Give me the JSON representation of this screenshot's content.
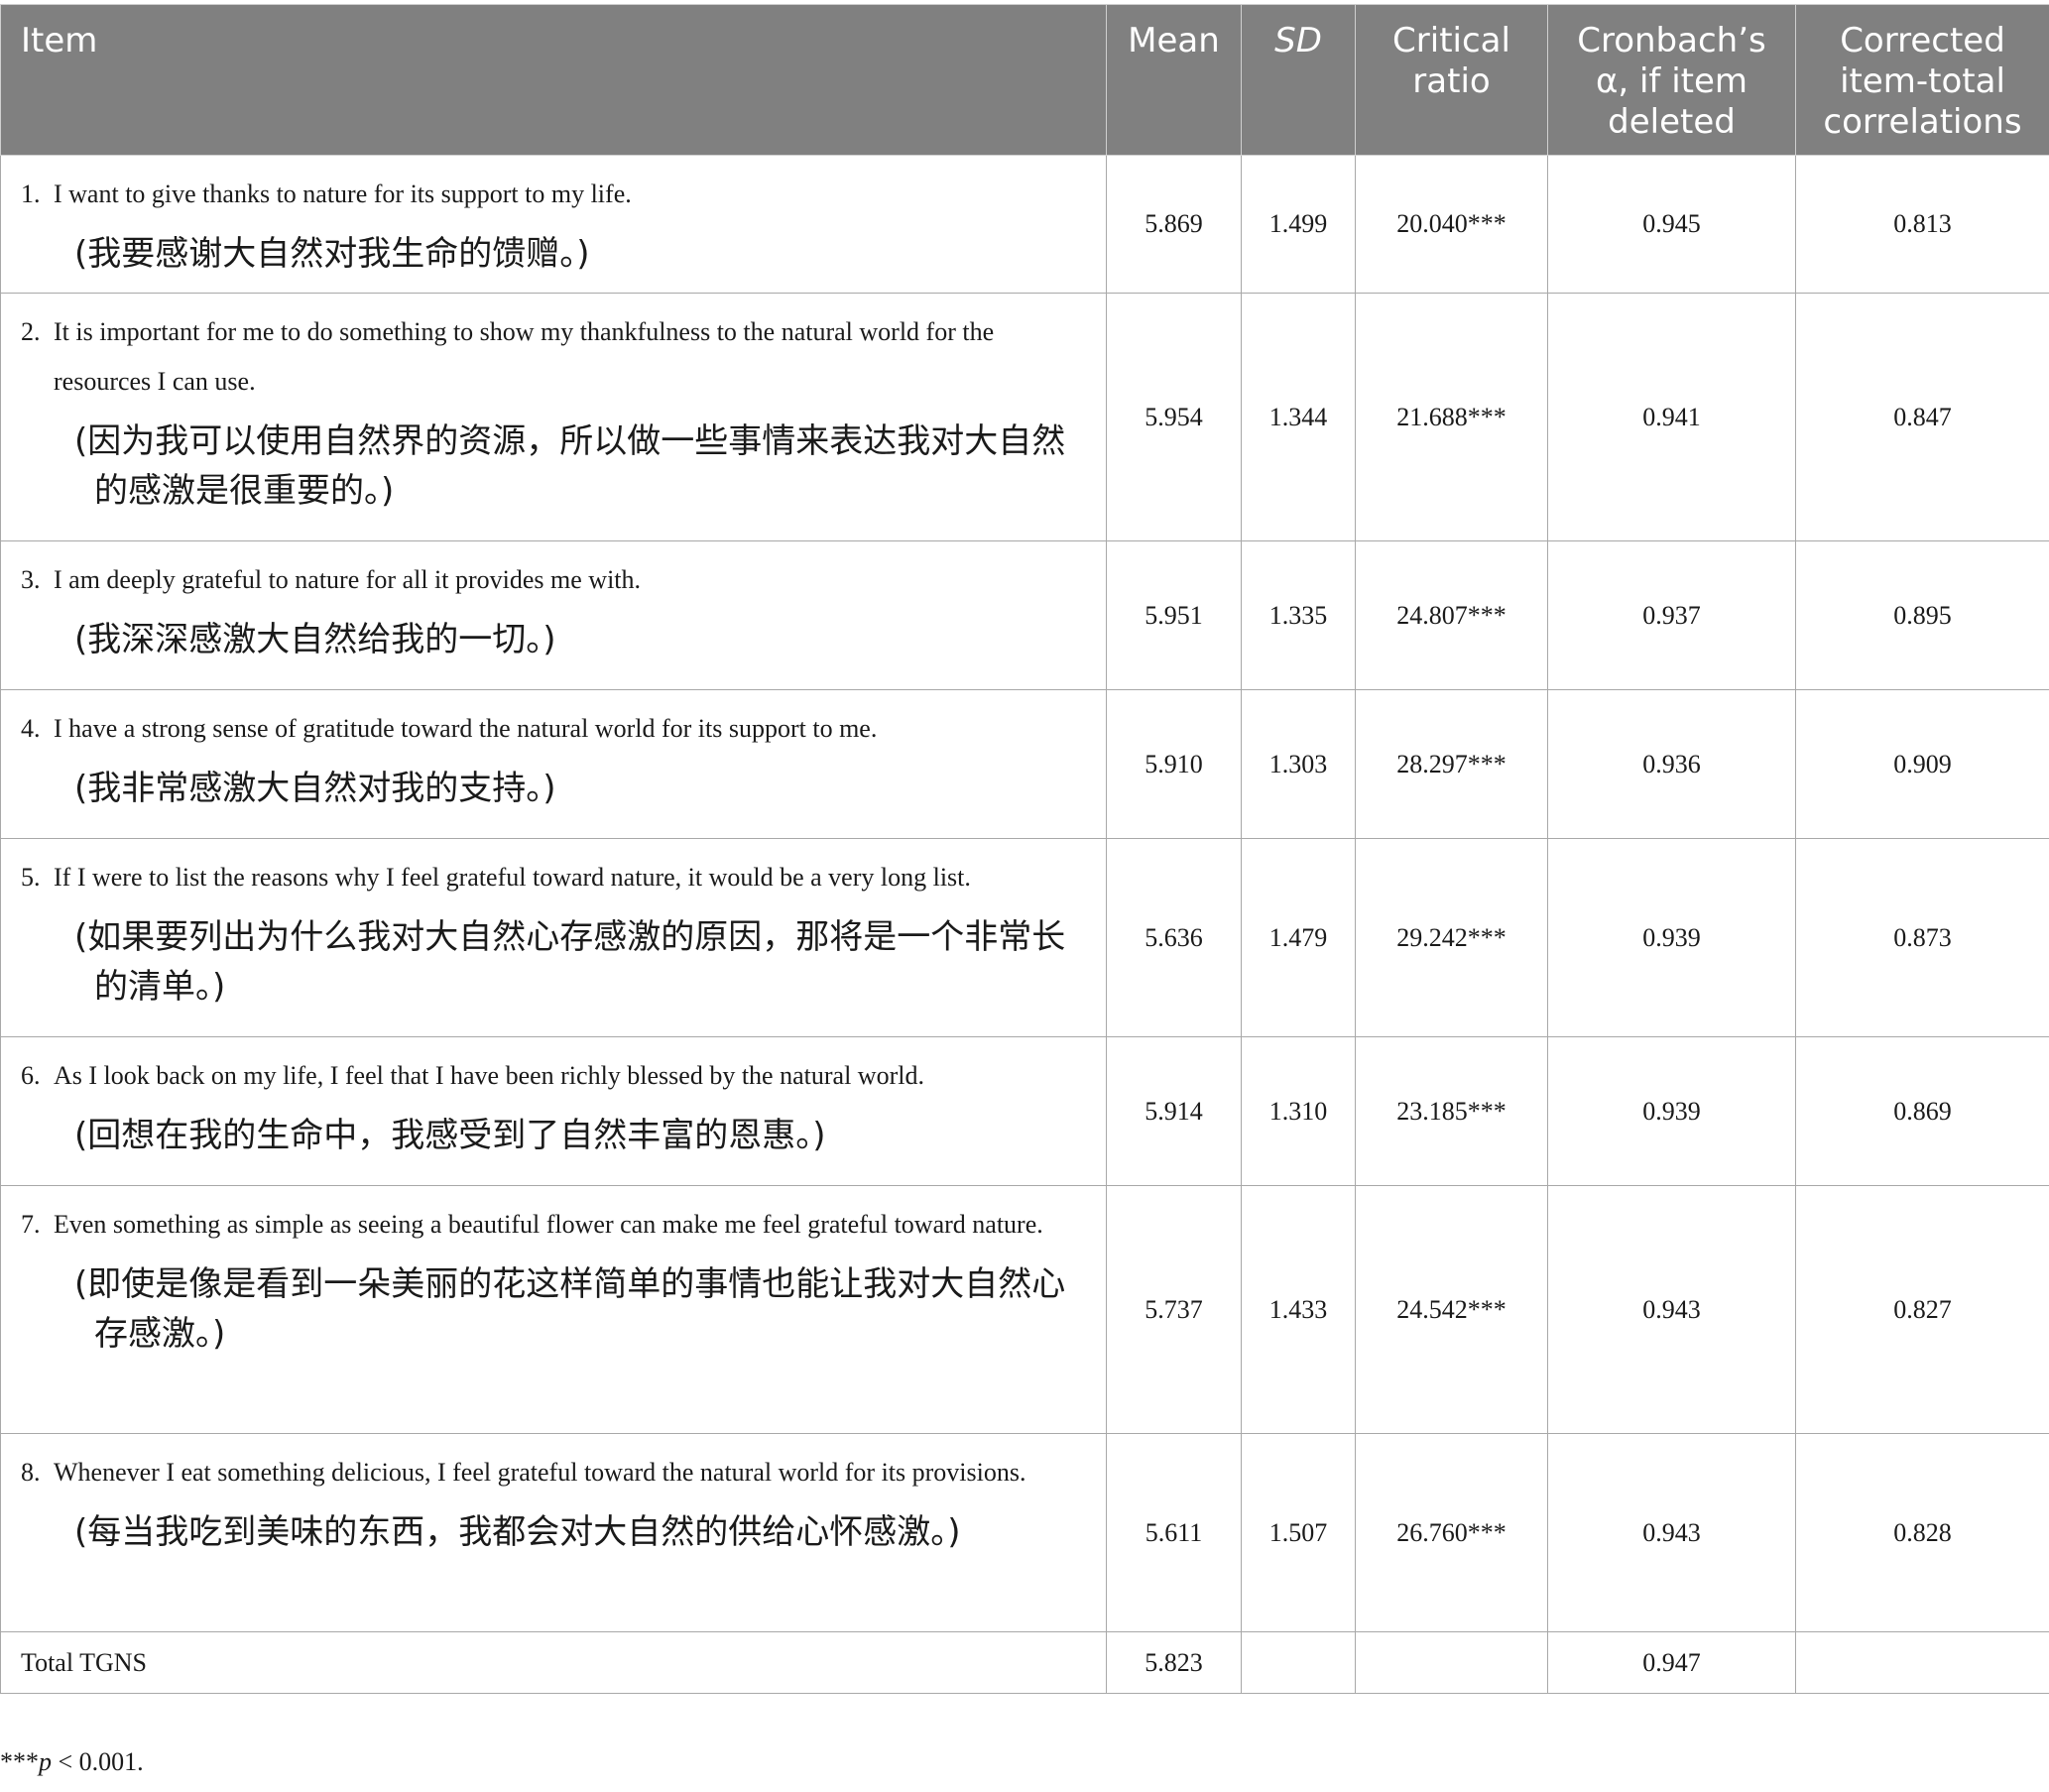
{
  "headers": {
    "item": "Item",
    "mean": "Mean",
    "sd": "SD",
    "critical_ratio": "Critical ratio",
    "alpha": "Cronbach’s α, if item deleted",
    "corrected": "Corrected item-total correlations"
  },
  "rows": [
    {
      "no": "1.",
      "en": "I want to give thanks to nature for its support to my life.",
      "zh": "(我要感谢大自然对我生命的馈赠。)",
      "mean": "5.869",
      "sd": "1.499",
      "cr": "20.040***",
      "alpha": "0.945",
      "corr": "0.813"
    },
    {
      "no": "2.",
      "en": "It is important for me to do something to show my thankfulness to the natural world for the resources I can use.",
      "zh": "(因为我可以使用自然界的资源，所以做一些事情来表达我对大自然的感激是很重要的。)",
      "mean": "5.954",
      "sd": "1.344",
      "cr": "21.688***",
      "alpha": "0.941",
      "corr": "0.847"
    },
    {
      "no": "3.",
      "en": "I am deeply grateful to nature for all it provides me with.",
      "zh": "(我深深感激大自然给我的一切。)",
      "mean": "5.951",
      "sd": "1.335",
      "cr": "24.807***",
      "alpha": "0.937",
      "corr": "0.895"
    },
    {
      "no": "4.",
      "en": "I have a strong sense of gratitude toward the natural world for its support to me.",
      "zh": "(我非常感激大自然对我的支持。)",
      "mean": "5.910",
      "sd": "1.303",
      "cr": "28.297***",
      "alpha": "0.936",
      "corr": "0.909"
    },
    {
      "no": "5.",
      "en": "If I were to list the reasons why I feel grateful toward nature, it would be a very long list.",
      "zh": "(如果要列出为什么我对大自然心存感激的原因，那将是一个非常长的清单。)",
      "mean": "5.636",
      "sd": "1.479",
      "cr": "29.242***",
      "alpha": "0.939",
      "corr": "0.873"
    },
    {
      "no": "6.",
      "en": "As I look back on my life, I feel that I have been richly blessed by the natural world.",
      "zh": "(回想在我的生命中，我感受到了自然丰富的恩惠。)",
      "mean": "5.914",
      "sd": "1.310",
      "cr": "23.185***",
      "alpha": "0.939",
      "corr": "0.869"
    },
    {
      "no": "7.",
      "en": "Even something as simple as seeing a beautiful flower can make me feel grateful toward nature.",
      "zh": "(即使是像是看到一朵美丽的花这样简单的事情也能让我对大自然心存感激。)",
      "mean": "5.737",
      "sd": "1.433",
      "cr": "24.542***",
      "alpha": "0.943",
      "corr": "0.827"
    },
    {
      "no": "8.",
      "en": "Whenever I eat something delicious, I feel grateful toward the natural world for its provisions.",
      "zh": "(每当我吃到美味的东西，我都会对大自然的供给心怀感激。)",
      "mean": "5.611",
      "sd": "1.507",
      "cr": "26.760***",
      "alpha": "0.943",
      "corr": "0.828"
    }
  ],
  "total": {
    "label": "Total TGNS",
    "mean": "5.823",
    "sd": "",
    "cr": "",
    "alpha": "0.947",
    "corr": ""
  },
  "footnote": {
    "stars": "***",
    "p": "p",
    "rest": " < 0.001."
  }
}
